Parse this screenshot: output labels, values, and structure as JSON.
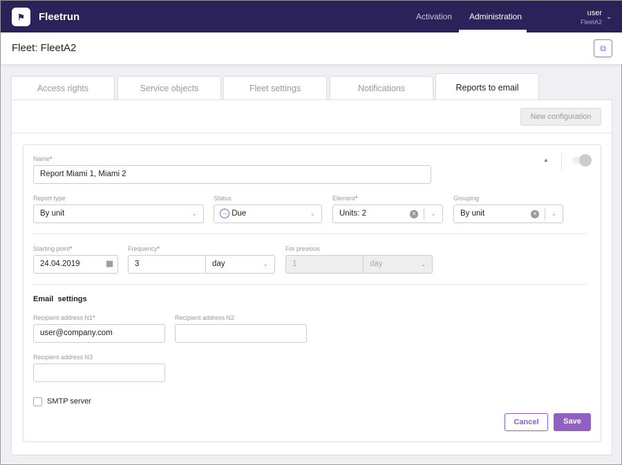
{
  "header": {
    "brand": "Fleetrun",
    "nav": [
      "Activation",
      "Administration"
    ],
    "user": "user",
    "fleet": "FleetA2"
  },
  "page": {
    "title": "Fleet: FleetA2"
  },
  "tabs": [
    "Access rights",
    "Service objects",
    "Fleet settings",
    "Notifications",
    "Reports to email"
  ],
  "toolbar": {
    "new_config": "New configuration"
  },
  "form": {
    "name_label": "Name",
    "name_value": "Report Miami 1, Miami 2",
    "report_type_label": "Report type",
    "report_type": "By unit",
    "status_label": "Status",
    "status": "Due",
    "element_label": "Element",
    "element": "Units: 2",
    "grouping_label": "Grouping",
    "grouping": "By unit",
    "start_label": "Starting point",
    "start": "24.04.2019",
    "freq_label": "Frequency",
    "freq": "3",
    "freq_unit": "day",
    "prev_label": "For previous",
    "prev": "1",
    "prev_unit": "day",
    "email_heading": "Email  settings",
    "r1_label": "Recipient address N1",
    "r1": "user@company.com",
    "r2_label": "Recipient address N2",
    "r2": "",
    "r3_label": "Recipient address N3",
    "r3": "",
    "smtp": "SMTP server",
    "cancel": "Cancel",
    "save": "Save",
    "star": "*"
  }
}
